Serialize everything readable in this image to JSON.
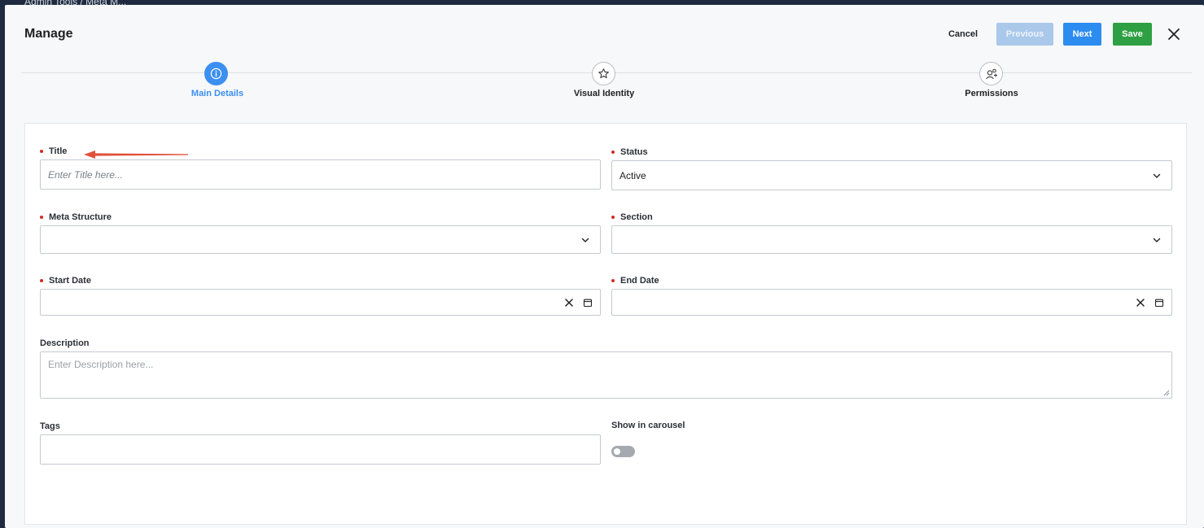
{
  "background": {
    "breadcrumb": "Admin Tools / Meta M..."
  },
  "header": {
    "title": "Manage",
    "cancel_label": "Cancel",
    "previous_label": "Previous",
    "next_label": "Next",
    "save_label": "Save"
  },
  "steps": [
    {
      "label": "Main Details",
      "icon": "info-icon",
      "active": true
    },
    {
      "label": "Visual Identity",
      "icon": "star-icon",
      "active": false
    },
    {
      "label": "Permissions",
      "icon": "user-permissions-icon",
      "active": false
    }
  ],
  "form": {
    "title": {
      "label": "Title",
      "placeholder": "Enter Title here..."
    },
    "status": {
      "label": "Status",
      "value": "Active"
    },
    "meta_structure": {
      "label": "Meta Structure",
      "value": ""
    },
    "section": {
      "label": "Section",
      "value": ""
    },
    "start_date": {
      "label": "Start Date",
      "value": ""
    },
    "end_date": {
      "label": "End Date",
      "value": ""
    },
    "description": {
      "label": "Description",
      "placeholder": "Enter Description here..."
    },
    "tags": {
      "label": "Tags",
      "value": ""
    },
    "show_in_carousel": {
      "label": "Show in carousel",
      "enabled": false
    }
  },
  "colors": {
    "primary": "#2d8cf0",
    "success": "#2ea043",
    "required": "#d02b2b",
    "annotation_arrow": "#e0503a"
  }
}
